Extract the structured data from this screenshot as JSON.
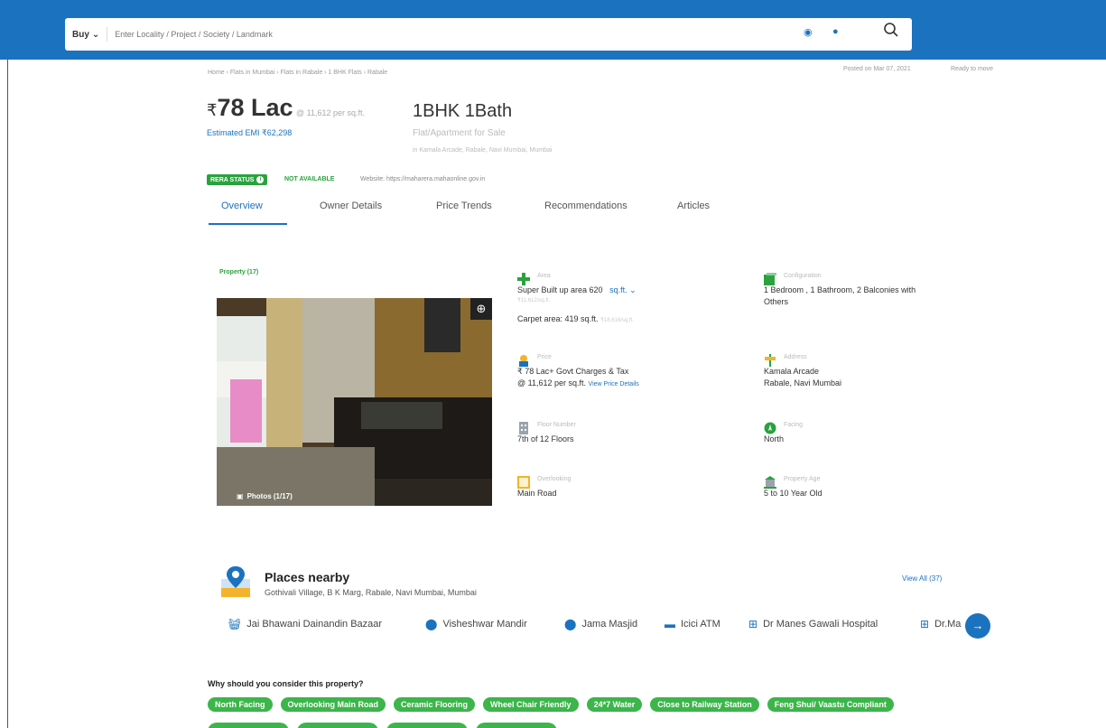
{
  "search": {
    "buy_label": "Buy",
    "placeholder": "Enter Locality / Project / Society / Landmark"
  },
  "breadcrumb": "Home › Flats in Mumbai › Flats in Rabale › 1 BHK Flats › Rabale",
  "posted_on": "Posted on Mar 07, 2021",
  "status": "Ready to move",
  "price": {
    "currency": "₹",
    "amount": "78 Lac",
    "per_sqft": "@ 11,612 per sq.ft.",
    "emi": "Estimated EMI ₹62,298"
  },
  "title": {
    "bhk": "1BHK 1Bath",
    "type": "Flat/Apartment for Sale",
    "address": "in Kamala Arcade, Rabale, Navi Mumbai, Mumbai"
  },
  "rera": {
    "badge": "RERA STATUS",
    "value": "NOT AVAILABLE",
    "website": "Website: https://maharera.mahaonline.gov.in"
  },
  "tabs": [
    {
      "label": "Overview",
      "active": true
    },
    {
      "label": "Owner Details"
    },
    {
      "label": "Price Trends"
    },
    {
      "label": "Recommendations"
    },
    {
      "label": "Articles"
    }
  ],
  "gallery": {
    "label": "Property (17)",
    "photo_count": "Photos (1/17)"
  },
  "details": {
    "area": {
      "label": "Area",
      "super_built": "Super Built up area 620",
      "unit": "sq.ft.",
      "super_sub": "₹11,612/sq.ft.",
      "carpet": "Carpet area: 419 sq.ft.",
      "carpet_sub": "₹18,616/sq.ft."
    },
    "configuration": {
      "label": "Configuration",
      "line1": "1 Bedroom , 1 Bathroom, 2 Balconies with",
      "line2": "Others"
    },
    "price": {
      "label": "Price",
      "line1": "₹ 78 Lac+ Govt Charges & Tax",
      "line2": "@ 11,612 per sq.ft.",
      "link": "View Price Details"
    },
    "address": {
      "label": "Address",
      "line1": "Kamala Arcade",
      "line2": "Rabale, Navi Mumbai"
    },
    "floor": {
      "label": "Floor Number",
      "line1": "7th of 12 Floors"
    },
    "facing": {
      "label": "Facing",
      "line1": "North"
    },
    "overlooking": {
      "label": "Overlooking",
      "line1": "Main Road"
    },
    "age": {
      "label": "Property Age",
      "line1": "5 to 10 Year Old"
    }
  },
  "places": {
    "title": "Places nearby",
    "address": "Gothivali Village, B K Marg, Rabale, Navi Mumbai, Mumbai",
    "view_all": "View All (37)",
    "items": [
      "Jai Bhawani Dainandin Bazaar",
      "Visheshwar Mandir",
      "Jama Masjid",
      "Icici ATM",
      "Dr Manes Gawali Hospital",
      "Dr.Ma"
    ]
  },
  "why": {
    "title": "Why should you consider this property?",
    "chips": [
      "North Facing",
      "Overlooking Main Road",
      "Ceramic Flooring",
      "Wheel Chair Friendly",
      "24*7 Water",
      "Close to Railway Station",
      "Feng Shui/ Vaastu Compliant"
    ]
  }
}
